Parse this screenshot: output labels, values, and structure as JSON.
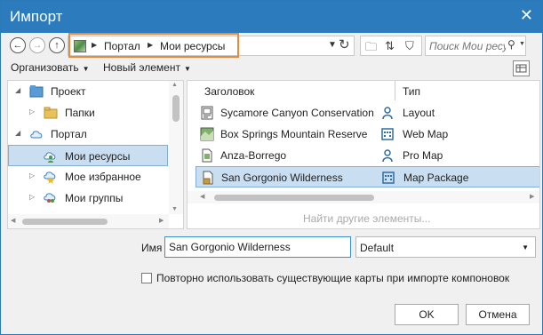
{
  "window": {
    "title": "Импорт",
    "close_glyph": "✕"
  },
  "breadcrumb": {
    "items": [
      "Портал",
      "Мои ресурсы"
    ]
  },
  "search": {
    "placeholder": "Поиск Мои ресу"
  },
  "menus": {
    "organize": "Организовать",
    "new_item": "Новый элемент"
  },
  "tree": {
    "items": [
      {
        "label": "Проект",
        "icon": "project-icon"
      },
      {
        "label": "Папки",
        "icon": "folder-icon"
      },
      {
        "label": "Портал",
        "icon": "cloud-icon"
      },
      {
        "label": "Мои ресурсы",
        "icon": "user-content-icon",
        "selected": true
      },
      {
        "label": "Мое избранное",
        "icon": "favorites-icon"
      },
      {
        "label": "Мои группы",
        "icon": "groups-icon"
      }
    ]
  },
  "list": {
    "columns": [
      "Заголовок",
      "Тип"
    ],
    "rows": [
      {
        "name": "Sycamore Canyon Conservation",
        "type": "Layout",
        "icon": "layout-icon",
        "type_icon": "user-icon"
      },
      {
        "name": "Box Springs Mountain Reserve",
        "type": "Web Map",
        "icon": "map-icon",
        "type_icon": "org-icon"
      },
      {
        "name": "Anza-Borrego",
        "type": "Pro Map",
        "icon": "document-icon",
        "type_icon": "user-icon"
      },
      {
        "name": "San Gorgonio Wilderness",
        "type": "Map Package",
        "icon": "package-icon",
        "type_icon": "org-icon",
        "selected": true
      }
    ],
    "find_more": "Найти другие элементы..."
  },
  "form": {
    "name_label": "Имя",
    "name_value": "San Gorgonio Wilderness",
    "select_value": "Default",
    "checkbox_label": "Повторно использовать существующие карты при импорте компоновок"
  },
  "buttons": {
    "ok": "OK",
    "cancel": "Отмена"
  },
  "colors": {
    "accent": "#2b7bbd",
    "highlight": "#e58c3c",
    "selection": "#c9def1"
  }
}
